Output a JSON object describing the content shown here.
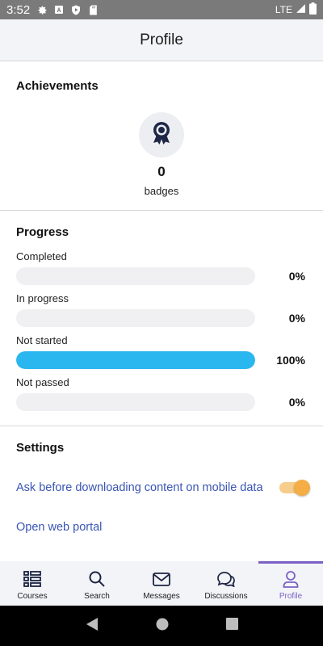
{
  "status_bar": {
    "time": "3:52",
    "network": "LTE"
  },
  "app_bar": {
    "title": "Profile"
  },
  "achievements": {
    "title": "Achievements",
    "badge_count": "0",
    "badge_label": "badges",
    "icon": "award-ribbon-icon"
  },
  "progress": {
    "title": "Progress",
    "rows": [
      {
        "label": "Completed",
        "value": 0,
        "percent_text": "0%"
      },
      {
        "label": "In progress",
        "value": 0,
        "percent_text": "0%"
      },
      {
        "label": "Not started",
        "value": 100,
        "percent_text": "100%"
      },
      {
        "label": "Not passed",
        "value": 0,
        "percent_text": "0%"
      }
    ],
    "bar_color": "#2ab7ef"
  },
  "settings": {
    "title": "Settings",
    "mobile_data_label": "Ask before downloading content on mobile data",
    "mobile_data_toggle": true,
    "web_portal_label": "Open web portal"
  },
  "bottom_nav": {
    "items": [
      {
        "label": "Courses",
        "icon": "courses-icon"
      },
      {
        "label": "Search",
        "icon": "search-icon"
      },
      {
        "label": "Messages",
        "icon": "envelope-icon"
      },
      {
        "label": "Discussions",
        "icon": "chat-bubbles-icon"
      },
      {
        "label": "Profile",
        "icon": "person-icon"
      }
    ],
    "active": "Profile",
    "active_color": "#7b61c6"
  }
}
